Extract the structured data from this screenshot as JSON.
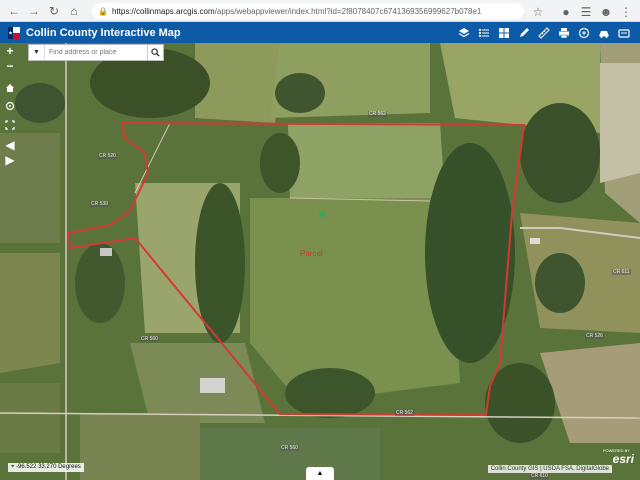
{
  "browser": {
    "url_host": "https://collinmaps.arcgis.com",
    "url_path": "/apps/webappviewer/index.html?id=2f8078407c6741369356999627b078e1",
    "lock_icon": "lock-icon",
    "star_icon": "star-icon"
  },
  "app": {
    "title": "Collin County Interactive Map",
    "logo_icon": "texas-flag-icon",
    "header_color": "#0d5aa7",
    "tools": [
      "layers-icon",
      "legend-icon",
      "basemap-gallery-icon",
      "draw-icon",
      "measure-icon",
      "print-icon",
      "share-icon",
      "car-icon",
      "school-icon"
    ]
  },
  "search": {
    "placeholder": "Find address or place"
  },
  "map_controls": [
    "zoom-in-icon",
    "zoom-out-icon",
    "home-icon",
    "locate-icon",
    "fullscreen-icon",
    "back-extent-icon",
    "forward-extent-icon"
  ],
  "map": {
    "parcel_outline_color": "#d33a33",
    "parcel_label": "Parcel",
    "road_labels": [
      "CR 562",
      "CR 520",
      "CR 539",
      "CR 560",
      "CR 562",
      "CR 611",
      "CR 526",
      "CR 560",
      "CR 610"
    ]
  },
  "footer": {
    "coords": "-96.522 33.270 Degrees",
    "attribution": "Collin County GIS | USDA FSA, DigitalGlobe",
    "esri_small": "POWERED BY",
    "esri_logo": "esri"
  }
}
